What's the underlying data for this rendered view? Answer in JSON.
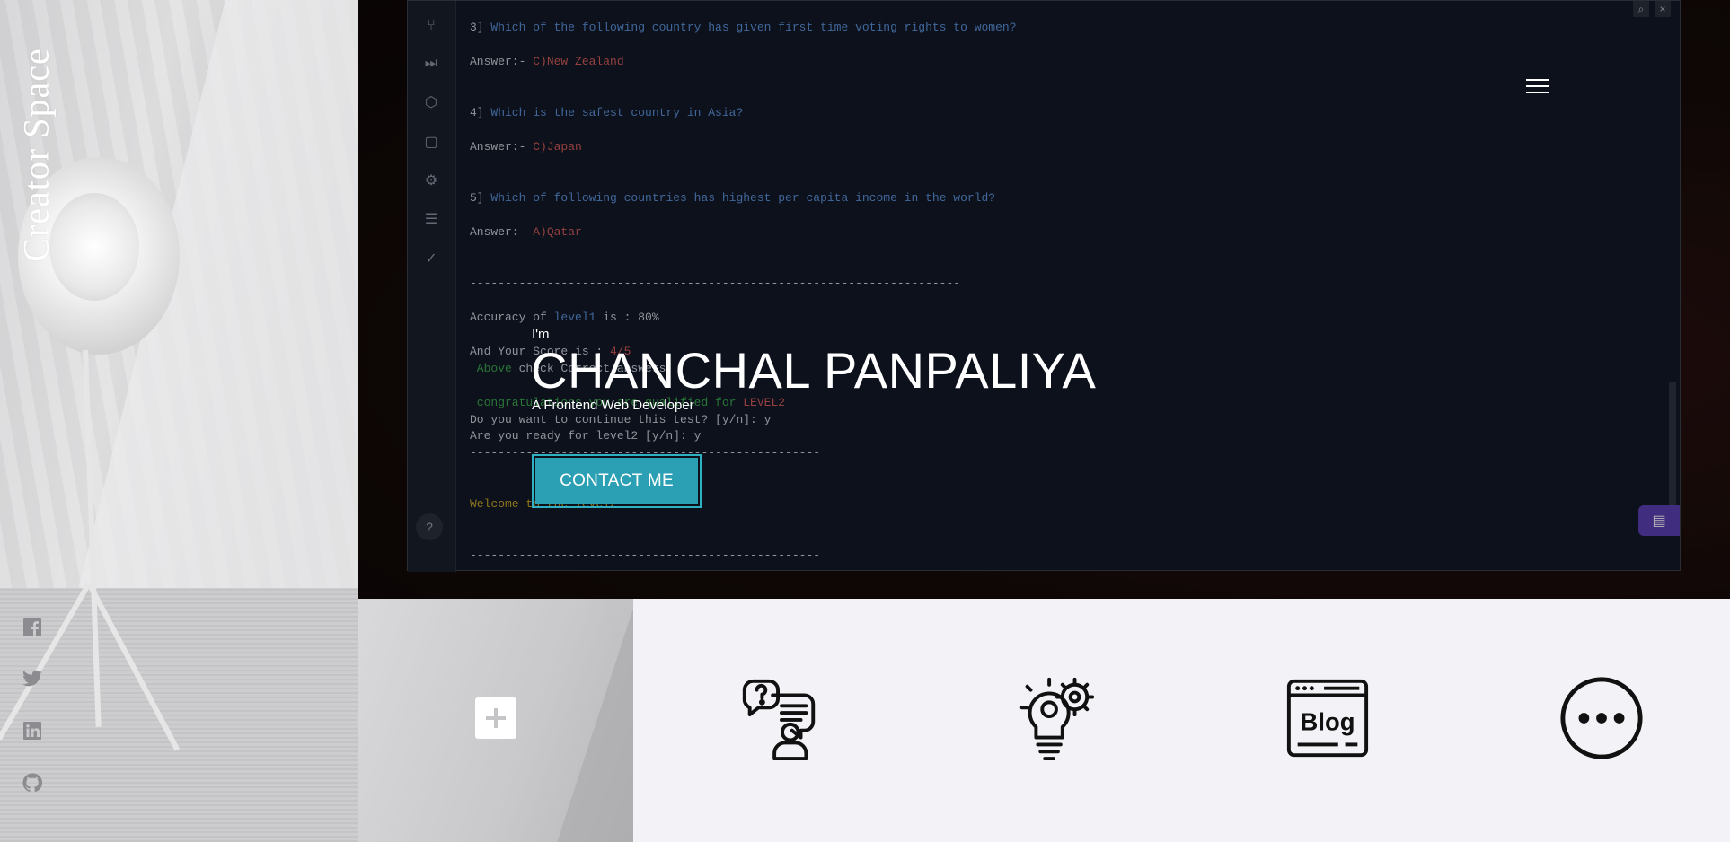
{
  "sidebar": {
    "brand": "Creator Space",
    "social": [
      {
        "name": "facebook-icon"
      },
      {
        "name": "twitter-icon"
      },
      {
        "name": "linkedin-icon"
      },
      {
        "name": "github-icon"
      }
    ]
  },
  "hero": {
    "greeting": "I'm",
    "name": "CHANCHAL PANPALIYA",
    "role": "A Frontend Web Developer",
    "cta_label": "CONTACT ME",
    "menu_icon": "hamburger-icon"
  },
  "terminal": {
    "lines": [
      {
        "prefix": "3] ",
        "text": "Which of the following country has given first time voting rights to women?"
      },
      {
        "prefix": "Answer:- ",
        "text": "C)New Zealand"
      },
      {
        "prefix": "4] ",
        "text": "Which is the safest country in Asia?"
      },
      {
        "prefix": "Answer:- ",
        "text": "C)Japan"
      },
      {
        "prefix": "5] ",
        "text": "Which of following countries has highest per capita income in the world?"
      },
      {
        "prefix": "Answer:- ",
        "text": "A)Qatar"
      },
      {
        "text": "----------------------------------------------------------------------"
      },
      {
        "prefix": "Accuracy of ",
        "hl": "level1",
        "text": " is : 80%"
      },
      {
        "prefix": "And Your Score is : ",
        "hl": "4/5"
      },
      {
        "hl": " Above",
        "text": " check Correct answers"
      },
      {
        "hl": " congratulations you are qualified for ",
        "text": "LEVEL2"
      },
      {
        "text": "Do you want to continue this test? [y/n]: y"
      },
      {
        "text": "Are you ready for level2 [y/n]: y"
      },
      {
        "text": "--------------------------------------------------"
      },
      {
        "text": "Welcome to the level2"
      },
      {
        "text": "--------------------------------------------------"
      }
    ],
    "search_icon": "search-icon",
    "close_icon": "close-icon",
    "help_label": "?"
  },
  "services": [
    {
      "name": "faq-support-icon"
    },
    {
      "name": "ideas-gears-icon"
    },
    {
      "name": "blog-icon"
    },
    {
      "name": "more-icon"
    }
  ],
  "colors": {
    "accent": "#2b9fb3",
    "accent_border": "#2fb0c3",
    "answer": "#d05a58",
    "question": "#5b8fd6",
    "chat": "#5b3fb0"
  }
}
